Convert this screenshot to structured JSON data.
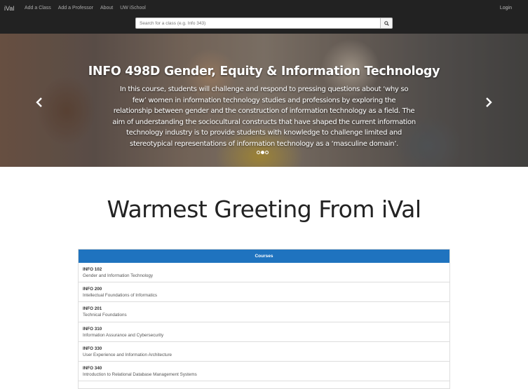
{
  "navbar": {
    "brand": "iVal",
    "links": [
      "Add a Class",
      "Add a Professor",
      "About",
      "UW iSchool"
    ],
    "login": "Login"
  },
  "search": {
    "placeholder": "Search for a class (e.g. Info 343)",
    "icon": "search-icon"
  },
  "hero": {
    "title": "INFO 498D Gender, Equity & Information Technology",
    "description": "In this course, students will challenge and respond to pressing questions about ‘why so few’ women in information technology studies and professions by exploring the relationship between gender and the construction of information technology as a field. The aim of understanding the sociocultural constructs that have shaped the current information technology industry is to provide students with knowledge to challenge limited and stereotypical representations of information technology as a ‘masculine domain’.",
    "slide_count": 3,
    "active_slide": 1
  },
  "greeting": "Warmest Greeting From iVal",
  "courses": {
    "heading": "Courses",
    "items": [
      {
        "code": "INFO 102",
        "name": "Gender and Information Technology"
      },
      {
        "code": "INFO 200",
        "name": "Intellectual Foundations of Informatics"
      },
      {
        "code": "INFO 201",
        "name": "Technical Foundations"
      },
      {
        "code": "INFO 310",
        "name": "Information Assurance and Cybersecurity"
      },
      {
        "code": "INFO 330",
        "name": "User Experience and Information Architecture"
      },
      {
        "code": "INFO 340",
        "name": "Introduction to Relational Database Management Systems"
      }
    ]
  },
  "colors": {
    "navbar": "#222222",
    "panel_heading": "#1f73bf"
  }
}
